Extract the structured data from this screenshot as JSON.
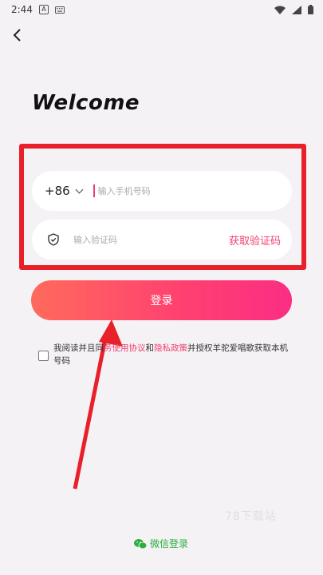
{
  "status_bar": {
    "time": "2:44"
  },
  "header": {
    "back_icon": "back-arrow-icon",
    "title": "Welcome"
  },
  "phone": {
    "country_code": "+86",
    "placeholder": "输入手机号码"
  },
  "code": {
    "icon": "shield-icon",
    "placeholder": "输入验证码",
    "get_code_label": "获取验证码"
  },
  "login": {
    "label": "登录"
  },
  "agreement": {
    "prefix": "我阅读并且同",
    "link1": "务使用协议",
    "and": "和",
    "link2": "隐私政策",
    "suffix": "并授权羊驼爱唱歌获取本机号码"
  },
  "watermark": "78下载站",
  "wechat": {
    "label": "微信登录"
  },
  "colors": {
    "accent": "#ef3e6e",
    "highlight_border": "#e8202a",
    "wechat_green": "#2aae3e"
  }
}
